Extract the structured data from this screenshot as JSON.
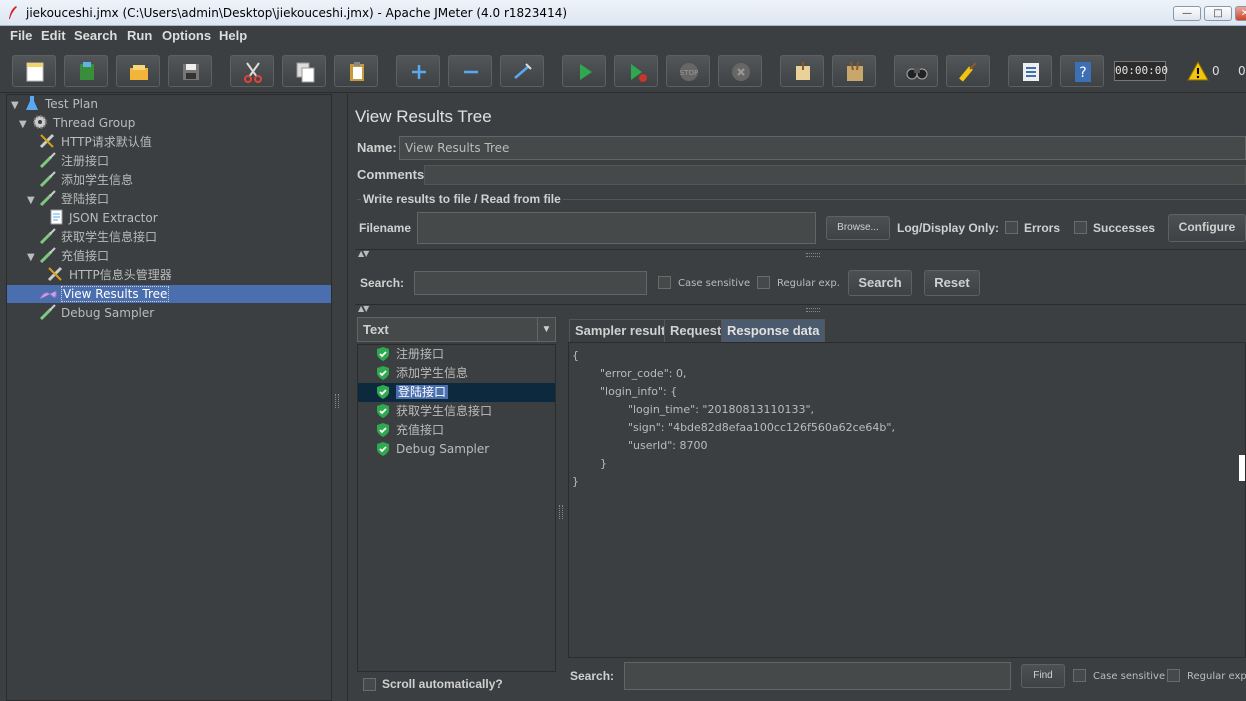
{
  "window": {
    "title": "jiekouceshi.jmx (C:\\Users\\admin\\Desktop\\jiekouceshi.jmx) - Apache JMeter (4.0 r1823414)",
    "minimize": "—",
    "maximize": "□",
    "close": "✕"
  },
  "menu": [
    "File",
    "Edit",
    "Search",
    "Run",
    "Options",
    "Help"
  ],
  "toolbar": {
    "timer": "00:00:00",
    "warnings": "0",
    "errors": "0"
  },
  "tree": {
    "items": [
      {
        "label": "Test Plan"
      },
      {
        "label": "Thread Group"
      },
      {
        "label": "HTTP请求默认值"
      },
      {
        "label": "注册接口"
      },
      {
        "label": "添加学生信息"
      },
      {
        "label": "登陆接口"
      },
      {
        "label": "JSON Extractor"
      },
      {
        "label": "获取学生信息接口"
      },
      {
        "label": "充值接口"
      },
      {
        "label": "HTTP信息头管理器"
      },
      {
        "label": "View Results Tree"
      },
      {
        "label": "Debug Sampler"
      }
    ]
  },
  "panel": {
    "title": "View Results Tree",
    "name_label": "Name:",
    "name_value": "View Results Tree",
    "comments_label": "Comments:",
    "write_section": "Write results to file / Read from file",
    "filename_label": "Filename",
    "browse": "Browse...",
    "log_display": "Log/Display Only:",
    "errors": "Errors",
    "successes": "Successes",
    "configure": "Configure",
    "search_label": "Search:",
    "case_sensitive": "Case sensitive",
    "regular_exp": "Regular exp.",
    "search_btn": "Search",
    "reset_btn": "Reset",
    "renderer": "Text",
    "scroll_auto": "Scroll automatically?"
  },
  "results": [
    {
      "label": "注册接口"
    },
    {
      "label": "添加学生信息"
    },
    {
      "label": "登陆接口"
    },
    {
      "label": "获取学生信息接口"
    },
    {
      "label": "充值接口"
    },
    {
      "label": "Debug Sampler"
    }
  ],
  "tabs": [
    "Sampler result",
    "Request",
    "Response data"
  ],
  "response": {
    "lines": [
      "{",
      "        \"error_code\": 0,",
      "        \"login_info\": {",
      "                \"login_time\": \"20180813110133\",",
      "                \"sign\": \"4bde82d8efaa100cc126f560a62ce64b\",",
      "                \"userId\": 8700",
      "        }",
      "}"
    ]
  },
  "bottom_search": {
    "label": "Search:",
    "find": "Find",
    "case_sensitive": "Case sensitive",
    "regular_exp": "Regular exp."
  }
}
